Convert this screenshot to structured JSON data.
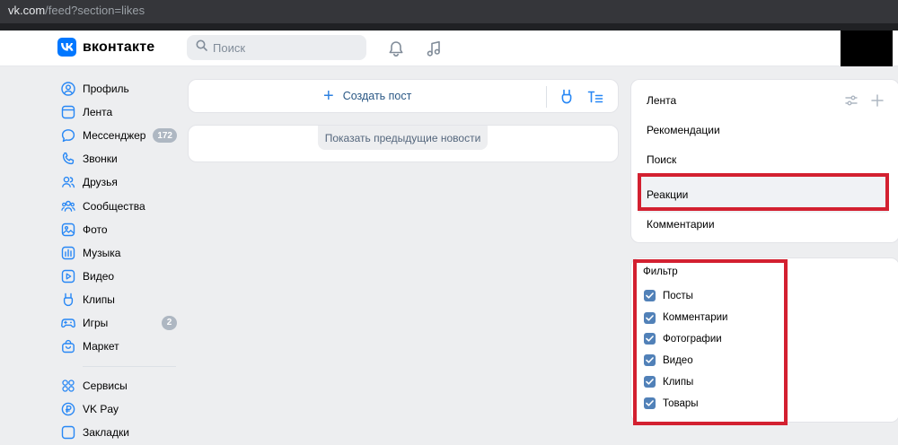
{
  "browser": {
    "url_host": "vk.com",
    "url_path": "/feed?section=likes"
  },
  "header": {
    "logo_text": "вконтакте",
    "search_placeholder": "Поиск",
    "icons": [
      "bell-icon",
      "music-icon"
    ]
  },
  "nav": {
    "items": [
      {
        "label": "Профиль",
        "icon": "profile-icon"
      },
      {
        "label": "Лента",
        "icon": "feed-icon"
      },
      {
        "label": "Мессенджер",
        "icon": "messenger-icon",
        "badge": "172"
      },
      {
        "label": "Звонки",
        "icon": "phone-icon"
      },
      {
        "label": "Друзья",
        "icon": "friends-icon"
      },
      {
        "label": "Сообщества",
        "icon": "communities-icon"
      },
      {
        "label": "Фото",
        "icon": "photo-icon"
      },
      {
        "label": "Музыка",
        "icon": "music-icon"
      },
      {
        "label": "Видео",
        "icon": "video-icon"
      },
      {
        "label": "Клипы",
        "icon": "clips-icon"
      },
      {
        "label": "Игры",
        "icon": "games-icon",
        "badge": "2"
      },
      {
        "label": "Маркет",
        "icon": "market-icon"
      }
    ],
    "secondary": [
      {
        "label": "Сервисы",
        "icon": "services-icon"
      },
      {
        "label": "VK Pay",
        "icon": "vkpay-icon"
      },
      {
        "label": "Закладки",
        "icon": "bookmarks-icon"
      }
    ]
  },
  "feed": {
    "create_post_label": "Создать пост",
    "show_previous_label": "Показать предыдущие новости"
  },
  "right_menu": {
    "items": [
      "Лента",
      "Рекомендации",
      "Поиск",
      "Реакции",
      "Комментарии"
    ],
    "selected": "Реакции"
  },
  "filter": {
    "title": "Фильтр",
    "options": [
      {
        "label": "Посты",
        "checked": true
      },
      {
        "label": "Комментарии",
        "checked": true
      },
      {
        "label": "Фотографии",
        "checked": true
      },
      {
        "label": "Видео",
        "checked": true
      },
      {
        "label": "Клипы",
        "checked": true
      },
      {
        "label": "Товары",
        "checked": true
      }
    ]
  },
  "colors": {
    "accent": "#0077ff",
    "link": "#2a5885",
    "checkbox": "#5181b8",
    "highlight_border": "#d32030"
  }
}
